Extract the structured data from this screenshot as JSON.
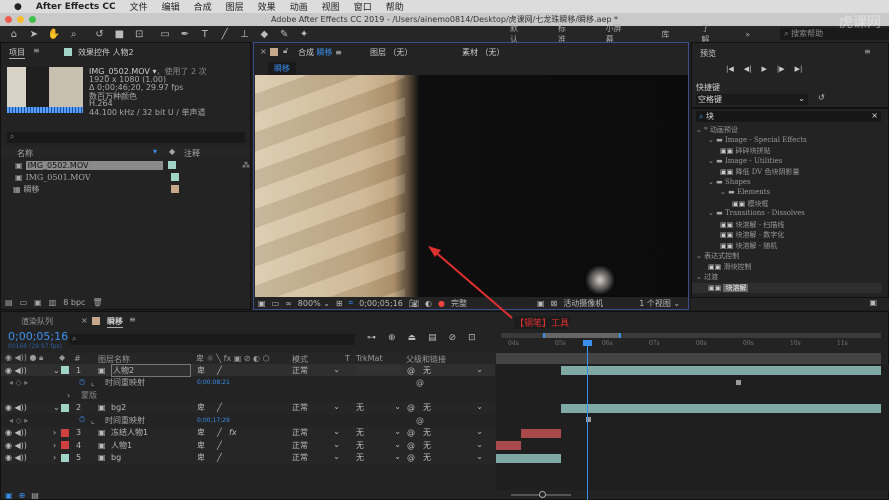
{
  "menubar": {
    "apple": "",
    "app": "After Effects CC",
    "items": [
      "文件",
      "编辑",
      "合成",
      "图层",
      "效果",
      "动画",
      "视图",
      "窗口",
      "帮助"
    ]
  },
  "titlebar": {
    "title": "Adobe After Effects CC 2019 - /Users/ainemo0814/Desktop/虎课网/七龙珠瞬移/瞬移.aep *"
  },
  "toolbar": {
    "tools": [
      "home-icon",
      "selection-icon",
      "hand-icon",
      "zoom-icon",
      "rotate-icon",
      "camera-icon",
      "pan-behind-icon",
      "rectangle-icon",
      "pen-icon",
      "text-icon",
      "brush-icon",
      "clone-stamp-icon",
      "eraser-icon",
      "roto-brush-icon",
      "puppet-pin-icon"
    ],
    "workspaces": [
      "默认",
      "标准",
      "小屏幕",
      "库",
      "了解"
    ],
    "more": "»",
    "search_placeholder": "搜索帮助",
    "watermark": "虎课网"
  },
  "project": {
    "tab": "项目",
    "effects_tab": "效果控件 人物2",
    "selected_name": "IMG_0502.MOV ▾",
    "used": "，使用了 2 次",
    "info": [
      "1920 x 1080 (1.00)",
      "Δ 0;00;46;20, 29.97 fps",
      "数百万种颜色",
      "H.264",
      "44.100 kHz / 32 bit U / 单声道"
    ],
    "col_name": "名称",
    "col_comment": "注释",
    "items": [
      {
        "name": "IMG_0502.MOV",
        "color": "#9fd4c6"
      },
      {
        "name": "IMG_0501.MOV",
        "color": "#9fd4c6"
      },
      {
        "name": "瞬移",
        "color": "#c8a88a"
      }
    ],
    "bpc": "8 bpc"
  },
  "comp": {
    "tab_prefix": "合成",
    "tab_name": "瞬移",
    "layer_tab": "图层 （无）",
    "footage_tab": "素材 （无）",
    "breadcrumb": "瞬移",
    "zoom": "800%",
    "timecode": "0;00;05;16",
    "quality": "完整",
    "camera": "活动摄像机",
    "views": "1 个视图"
  },
  "annotation": {
    "text": "【钢笔】工具",
    "color": "#e03030"
  },
  "preview": {
    "title": "预览",
    "shortcut_label": "快捷键",
    "shortcut_value": "空格键"
  },
  "effects": {
    "search_value": "块",
    "tree": [
      {
        "level": 0,
        "label": "* 动画预设",
        "type": "group"
      },
      {
        "level": 1,
        "label": "Image - Special Effects",
        "type": "folder"
      },
      {
        "level": 2,
        "label": "碎碎块拼贴",
        "type": "item"
      },
      {
        "level": 1,
        "label": "Image - Utilities",
        "type": "folder"
      },
      {
        "level": 2,
        "label": "降低 DV 色块阴影量",
        "type": "item"
      },
      {
        "level": 1,
        "label": "Shapes",
        "type": "folder"
      },
      {
        "level": 2,
        "label": "Elements",
        "type": "folder"
      },
      {
        "level": 3,
        "label": "模块框",
        "type": "item"
      },
      {
        "level": 1,
        "label": "Transitions - Dissolves",
        "type": "folder"
      },
      {
        "level": 2,
        "label": "块溶解 - 扫描线",
        "type": "item"
      },
      {
        "level": 2,
        "label": "块溶解 - 数字化",
        "type": "item"
      },
      {
        "level": 2,
        "label": "块溶解 - 随机",
        "type": "item"
      },
      {
        "level": 0,
        "label": "表达式控制",
        "type": "group"
      },
      {
        "level": 1,
        "label": "滑块控制",
        "type": "item"
      },
      {
        "level": 0,
        "label": "过渡",
        "type": "group"
      },
      {
        "level": 1,
        "label": "块溶解",
        "type": "item",
        "selected": true
      }
    ]
  },
  "timeline": {
    "render_tab": "渲染队列",
    "comp_tab": "瞬移",
    "timecode": "0;00;05;16",
    "fps": "00166 (29.97 fps)",
    "headers": {
      "num": "#",
      "name": "图层名称",
      "mode": "模式",
      "t": "T",
      "trkmat": "TrkMat",
      "parent": "父级和链接"
    },
    "ruler": [
      "04s",
      "05s",
      "06s",
      "07s",
      "08s",
      "09s",
      "10s",
      "11s"
    ],
    "layers": [
      {
        "num": "1",
        "name": "人物2",
        "color": "#9fd4c6",
        "mode": "正常",
        "trkmat": "",
        "parent": "无",
        "fx": false,
        "remap": "0;00;08;21",
        "mask": "蒙版"
      },
      {
        "num": "2",
        "name": "bg2",
        "color": "#9fd4c6",
        "mode": "正常",
        "trkmat": "无",
        "parent": "无",
        "fx": false,
        "remap": "0;00;17;29"
      },
      {
        "num": "3",
        "name": "冻结人物1",
        "color": "#d04040",
        "mode": "正常",
        "trkmat": "无",
        "parent": "无",
        "fx": true
      },
      {
        "num": "4",
        "name": "人物1",
        "color": "#d04040",
        "mode": "正常",
        "trkmat": "无",
        "parent": "无",
        "fx": false
      },
      {
        "num": "5",
        "name": "bg",
        "color": "#9fd4c6",
        "mode": "正常",
        "trkmat": "无",
        "parent": "无",
        "fx": false
      }
    ],
    "remap_label": "时间重映射"
  },
  "colors": {
    "accent": "#2d8ceb",
    "teal_bar": "#7fa9a4",
    "red_bar": "#a84a4a"
  }
}
